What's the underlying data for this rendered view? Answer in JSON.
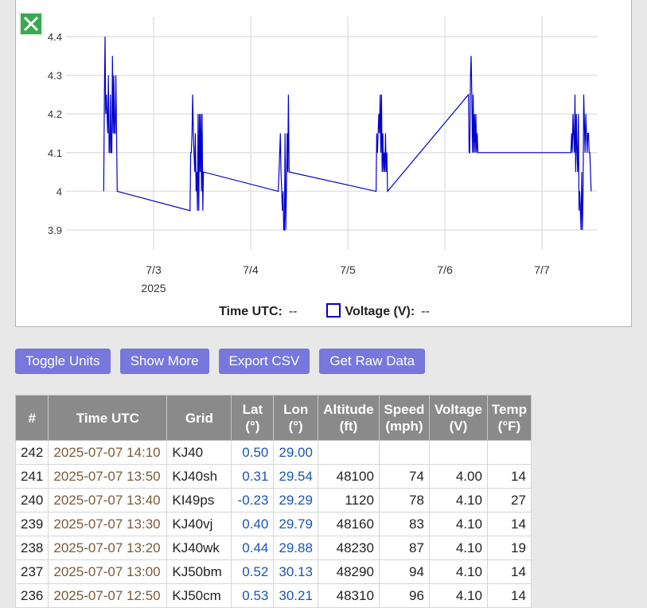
{
  "chart_data": {
    "type": "line",
    "x_ticks": [
      "7/3",
      "7/4",
      "7/5",
      "7/6",
      "7/7"
    ],
    "x_year_label": "2025",
    "y_ticks": [
      "4.4",
      "4.3",
      "4.2",
      "4.1",
      "4",
      "3.9"
    ],
    "ylim": [
      3.9,
      4.4
    ],
    "grid": true,
    "series": [
      {
        "name": "Voltage (V)",
        "color": "#0000cc",
        "points": [
          [
            "2025-07-02 11:40",
            4.0
          ],
          [
            "2025-07-02 11:50",
            4.25
          ],
          [
            "2025-07-02 12:00",
            4.4
          ],
          [
            "2025-07-02 12:10",
            4.2
          ],
          [
            "2025-07-02 12:20",
            4.25
          ],
          [
            "2025-07-02 12:30",
            4.2
          ],
          [
            "2025-07-02 12:40",
            4.15
          ],
          [
            "2025-07-02 12:50",
            4.3
          ],
          [
            "2025-07-02 13:00",
            4.1
          ],
          [
            "2025-07-02 13:10",
            4.1
          ],
          [
            "2025-07-02 13:20",
            4.25
          ],
          [
            "2025-07-02 13:30",
            4.1
          ],
          [
            "2025-07-02 13:40",
            4.1
          ],
          [
            "2025-07-02 13:50",
            4.35
          ],
          [
            "2025-07-02 14:00",
            4.15
          ],
          [
            "2025-07-02 14:10",
            4.3
          ],
          [
            "2025-07-02 14:20",
            4.15
          ],
          [
            "2025-07-02 14:30",
            4.15
          ],
          [
            "2025-07-02 14:40",
            4.3
          ],
          [
            "2025-07-02 15:00",
            4.0
          ],
          [
            "2025-07-03 09:00",
            3.95
          ],
          [
            "2025-07-03 09:10",
            4.1
          ],
          [
            "2025-07-03 09:20",
            4.1
          ],
          [
            "2025-07-03 09:30",
            4.15
          ],
          [
            "2025-07-03 09:40",
            4.25
          ],
          [
            "2025-07-03 09:50",
            4.15
          ],
          [
            "2025-07-03 10:00",
            4.1
          ],
          [
            "2025-07-03 10:10",
            4.05
          ],
          [
            "2025-07-03 10:20",
            4.15
          ],
          [
            "2025-07-03 10:30",
            4.0
          ],
          [
            "2025-07-03 10:40",
            4.05
          ],
          [
            "2025-07-03 10:50",
            3.95
          ],
          [
            "2025-07-03 11:00",
            4.2
          ],
          [
            "2025-07-03 11:10",
            3.95
          ],
          [
            "2025-07-03 11:20",
            4.2
          ],
          [
            "2025-07-03 11:30",
            4.05
          ],
          [
            "2025-07-03 11:40",
            4.2
          ],
          [
            "2025-07-03 11:50",
            4.0
          ],
          [
            "2025-07-03 12:00",
            4.2
          ],
          [
            "2025-07-03 12:10",
            3.95
          ],
          [
            "2025-07-03 12:20",
            4.05
          ],
          [
            "2025-07-04 06:50",
            4.0
          ],
          [
            "2025-07-04 07:00",
            4.05
          ],
          [
            "2025-07-04 07:20",
            4.15
          ],
          [
            "2025-07-04 07:30",
            4.05
          ],
          [
            "2025-07-04 07:40",
            4.0
          ],
          [
            "2025-07-04 07:50",
            3.95
          ],
          [
            "2025-07-04 08:00",
            4.0
          ],
          [
            "2025-07-04 08:10",
            3.9
          ],
          [
            "2025-07-04 08:20",
            3.9
          ],
          [
            "2025-07-04 08:30",
            4.15
          ],
          [
            "2025-07-04 08:40",
            3.9
          ],
          [
            "2025-07-04 08:50",
            4.0
          ],
          [
            "2025-07-04 09:00",
            4.15
          ],
          [
            "2025-07-04 09:10",
            4.05
          ],
          [
            "2025-07-04 09:20",
            4.25
          ],
          [
            "2025-07-04 09:30",
            4.05
          ],
          [
            "2025-07-05 07:00",
            4.0
          ],
          [
            "2025-07-05 07:10",
            4.15
          ],
          [
            "2025-07-05 07:20",
            4.1
          ],
          [
            "2025-07-05 07:30",
            4.15
          ],
          [
            "2025-07-05 07:40",
            4.2
          ],
          [
            "2025-07-05 07:50",
            4.15
          ],
          [
            "2025-07-05 08:00",
            4.25
          ],
          [
            "2025-07-05 08:10",
            4.1
          ],
          [
            "2025-07-05 08:20",
            4.25
          ],
          [
            "2025-07-05 08:30",
            4.05
          ],
          [
            "2025-07-05 08:40",
            4.15
          ],
          [
            "2025-07-05 08:50",
            4.05
          ],
          [
            "2025-07-05 09:00",
            4.1
          ],
          [
            "2025-07-05 09:10",
            4.05
          ],
          [
            "2025-07-05 09:20",
            4.15
          ],
          [
            "2025-07-05 09:30",
            4.05
          ],
          [
            "2025-07-05 09:40",
            4.1
          ],
          [
            "2025-07-05 09:50",
            4.0
          ],
          [
            "2025-07-06 05:50",
            4.25
          ],
          [
            "2025-07-06 06:00",
            4.1
          ],
          [
            "2025-07-06 06:10",
            4.1
          ],
          [
            "2025-07-06 06:20",
            4.3
          ],
          [
            "2025-07-06 06:30",
            4.35
          ],
          [
            "2025-07-06 06:40",
            4.25
          ],
          [
            "2025-07-06 06:50",
            4.1
          ],
          [
            "2025-07-06 07:00",
            4.25
          ],
          [
            "2025-07-06 07:10",
            4.1
          ],
          [
            "2025-07-06 07:20",
            4.2
          ],
          [
            "2025-07-06 07:30",
            4.1
          ],
          [
            "2025-07-06 07:40",
            4.2
          ],
          [
            "2025-07-06 07:50",
            4.1
          ],
          [
            "2025-07-06 08:00",
            4.15
          ],
          [
            "2025-07-06 08:10",
            4.1
          ],
          [
            "2025-07-07 07:10",
            4.1
          ],
          [
            "2025-07-07 07:20",
            4.15
          ],
          [
            "2025-07-07 07:30",
            4.1
          ],
          [
            "2025-07-07 07:40",
            4.2
          ],
          [
            "2025-07-07 07:50",
            4.15
          ],
          [
            "2025-07-07 08:00",
            4.1
          ],
          [
            "2025-07-07 08:10",
            4.25
          ],
          [
            "2025-07-07 08:20",
            4.05
          ],
          [
            "2025-07-07 08:30",
            4.2
          ],
          [
            "2025-07-07 08:40",
            4.1
          ],
          [
            "2025-07-07 08:50",
            4.05
          ],
          [
            "2025-07-07 09:00",
            4.2
          ],
          [
            "2025-07-07 09:10",
            3.95
          ],
          [
            "2025-07-07 09:20",
            4.0
          ],
          [
            "2025-07-07 09:30",
            3.95
          ],
          [
            "2025-07-07 09:40",
            3.9
          ],
          [
            "2025-07-07 09:50",
            4.05
          ],
          [
            "2025-07-07 10:00",
            3.9
          ],
          [
            "2025-07-07 10:10",
            4.0
          ],
          [
            "2025-07-07 10:20",
            4.25
          ],
          [
            "2025-07-07 10:40",
            4.1
          ],
          [
            "2025-07-07 10:50",
            4.2
          ],
          [
            "2025-07-07 11:00",
            4.15
          ],
          [
            "2025-07-07 11:10",
            4.1
          ],
          [
            "2025-07-07 11:20",
            4.15
          ],
          [
            "2025-07-07 11:30",
            4.15
          ],
          [
            "2025-07-07 11:40",
            4.1
          ],
          [
            "2025-07-07 11:50",
            4.1
          ],
          [
            "2025-07-07 12:10",
            4.0
          ]
        ]
      }
    ]
  },
  "legend": {
    "time_label": "Time UTC:",
    "time_value": "--",
    "series_label": "Voltage (V):",
    "series_value": "--",
    "series_color": "#0000cc"
  },
  "toolbar": {
    "buttons": [
      "Toggle Units",
      "Show More",
      "Export CSV",
      "Get Raw Data"
    ]
  },
  "table": {
    "headers": [
      {
        "key": "num",
        "label": "#"
      },
      {
        "key": "time",
        "label": "Time UTC"
      },
      {
        "key": "grid",
        "label": "Grid"
      },
      {
        "key": "lat",
        "label": "Lat\n(°)"
      },
      {
        "key": "lon",
        "label": "Lon\n(°)"
      },
      {
        "key": "alt",
        "label": "Altitude\n(ft)"
      },
      {
        "key": "speed",
        "label": "Speed\n(mph)"
      },
      {
        "key": "voltage",
        "label": "Voltage\n(V)"
      },
      {
        "key": "temp",
        "label": "Temp\n(°F)"
      }
    ],
    "rows": [
      {
        "num": "242",
        "time": "2025-07-07 14:10",
        "grid": "KJ40",
        "lat": "0.50",
        "lon": "29.00",
        "alt": "",
        "speed": "",
        "voltage": "",
        "temp": ""
      },
      {
        "num": "241",
        "time": "2025-07-07 13:50",
        "grid": "KJ40sh",
        "lat": "0.31",
        "lon": "29.54",
        "alt": "48100",
        "speed": "74",
        "voltage": "4.00",
        "temp": "14"
      },
      {
        "num": "240",
        "time": "2025-07-07 13:40",
        "grid": "KI49ps",
        "lat": "-0.23",
        "lon": "29.29",
        "alt": "1120",
        "speed": "78",
        "voltage": "4.10",
        "temp": "27"
      },
      {
        "num": "239",
        "time": "2025-07-07 13:30",
        "grid": "KJ40vj",
        "lat": "0.40",
        "lon": "29.79",
        "alt": "48160",
        "speed": "83",
        "voltage": "4.10",
        "temp": "14"
      },
      {
        "num": "238",
        "time": "2025-07-07 13:20",
        "grid": "KJ40wk",
        "lat": "0.44",
        "lon": "29.88",
        "alt": "48230",
        "speed": "87",
        "voltage": "4.10",
        "temp": "19"
      },
      {
        "num": "237",
        "time": "2025-07-07 13:00",
        "grid": "KJ50bm",
        "lat": "0.52",
        "lon": "30.13",
        "alt": "48290",
        "speed": "94",
        "voltage": "4.10",
        "temp": "14"
      },
      {
        "num": "236",
        "time": "2025-07-07 12:50",
        "grid": "KJ50cm",
        "lat": "0.53",
        "lon": "30.21",
        "alt": "48310",
        "speed": "96",
        "voltage": "4.10",
        "temp": "14"
      }
    ]
  }
}
